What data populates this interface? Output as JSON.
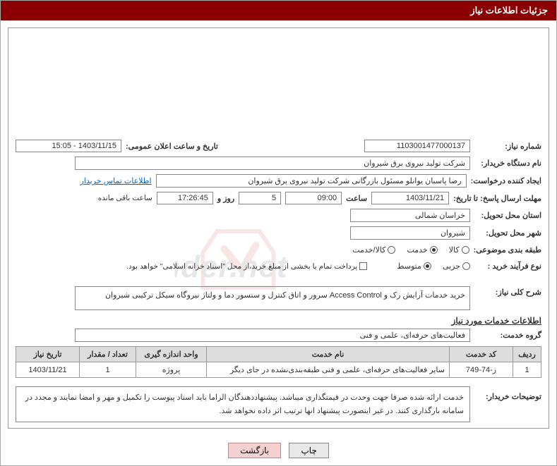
{
  "header": {
    "title": "جزئیات اطلاعات نیاز"
  },
  "fields": {
    "need_no_label": "شماره نیاز:",
    "need_no": "1103001477000137",
    "announce_label": "تاریخ و ساعت اعلان عمومی:",
    "announce": "1403/11/15 - 15:05",
    "org_label": "نام دستگاه خریدار:",
    "org": "شرکت تولید نیروی برق شیروان",
    "creator_label": "ایجاد کننده درخواست:",
    "creator": "رضا پاسبان یوانلو مسئول بازرگانی شرکت تولید نیروی برق شیروان",
    "contact_link": "اطلاعات تماس خریدار",
    "deadline_label": "مهلت ارسال پاسخ: تا تاریخ:",
    "deadline_date": "1403/11/21",
    "time_label": "ساعت",
    "deadline_time": "09:00",
    "days": "5",
    "days_label": "روز و",
    "remain_time": "17:26:45",
    "remain_label": "ساعت باقی مانده",
    "province_label": "استان محل تحویل:",
    "province": "خراسان شمالی",
    "city_label": "شهر محل تحویل:",
    "city": "شیروان",
    "category_label": "طبقه بندی موضوعی:",
    "cat_goods": "کالا",
    "cat_service": "خدمت",
    "cat_both": "کالا/خدمت",
    "proc_type_label": "نوع فرآیند خرید :",
    "proc_minor": "جزیی",
    "proc_medium": "متوسط",
    "pay_note": "پرداخت تمام یا بخشی از مبلغ خرید،از محل \"اسناد خزانه اسلامی\" خواهد بود.",
    "summary_label": "شرح کلی نیاز:",
    "summary": "خرید خدمات آرایش رک و Access Control سرور و اتاق کنترل و سنسور دما و ولتاژ نیروگاه سیکل ترکیبی شیروان",
    "section_title": "اطلاعات خدمات مورد نیاز",
    "group_label": "گروه خدمت:",
    "group": "فعالیت‌های حرفه‌ای، علمی و فنی",
    "desc_label": "توضیحات خریدار:",
    "desc": "خدمت ارائه شده صرفا جهت وحدت در قیمتگذاری میباشد. پیشنهاددهندگان الزاما باید اسناد پیوست را تکمیل و مهر و امضا نمایند و مجدد در سامانه بارگذاری کنند. در غیر اینصورت پیشنهاد انها ترتیب اثر داده نخواهد شد."
  },
  "table": {
    "headers": {
      "row": "ردیف",
      "code": "کد خدمت",
      "name": "نام خدمت",
      "unit": "واحد اندازه گیری",
      "qty": "تعداد / مقدار",
      "date": "تاریخ نیاز"
    },
    "rows": [
      {
        "row": "1",
        "code": "ز-74-749",
        "name": "سایر فعالیت‌های حرفه‌ای، علمی و فنی طبقه‌بندی‌نشده در جای دیگر",
        "unit": "پروژه",
        "qty": "1",
        "date": "1403/11/21"
      }
    ]
  },
  "buttons": {
    "print": "چاپ",
    "back": "بازگشت"
  },
  "watermark": "AriaTender.net"
}
